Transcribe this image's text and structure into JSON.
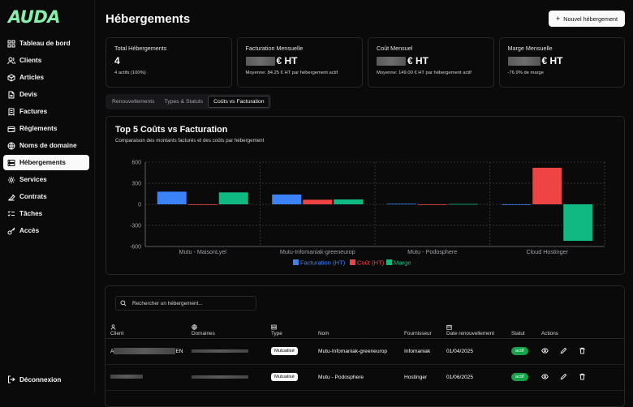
{
  "app": {
    "logo": "AUDA"
  },
  "sidebar": {
    "items": [
      {
        "label": "Tableau de bord",
        "icon": "grid-icon"
      },
      {
        "label": "Clients",
        "icon": "users-icon"
      },
      {
        "label": "Articles",
        "icon": "box-icon"
      },
      {
        "label": "Devis",
        "icon": "file-icon"
      },
      {
        "label": "Factures",
        "icon": "receipt-icon"
      },
      {
        "label": "Règlements",
        "icon": "wallet-icon"
      },
      {
        "label": "Noms de domaine",
        "icon": "globe-icon"
      },
      {
        "label": "Hébergements",
        "icon": "server-icon",
        "active": true
      },
      {
        "label": "Services",
        "icon": "settings-icon"
      },
      {
        "label": "Contrats",
        "icon": "contract-icon"
      },
      {
        "label": "Tâches",
        "icon": "checklist-icon"
      },
      {
        "label": "Accès",
        "icon": "key-icon"
      }
    ],
    "logout": "Déconnexion"
  },
  "header": {
    "title": "Hébergements",
    "new_button": "Nouvel hébergement"
  },
  "cards": [
    {
      "label": "Total Hébergements",
      "value": "4",
      "sub": "4 actifs (100%)"
    },
    {
      "label": "Facturation Mensuelle",
      "value": "€ HT",
      "sub": "Moyenne: 84.25 € HT par hébergement actif"
    },
    {
      "label": "Coût Mensuel",
      "value": "€ HT",
      "sub": "Moyenne: 149.00 € HT par hébergement actif"
    },
    {
      "label": "Marge Mensuelle",
      "value": "€ HT",
      "sub": "-76.9% de marge"
    }
  ],
  "tabs": [
    {
      "label": "Renouvellements"
    },
    {
      "label": "Types & Statuts"
    },
    {
      "label": "Coûts vs Facturation",
      "active": true
    }
  ],
  "chart_data": {
    "type": "bar",
    "title": "Top 5 Coûts vs Facturation",
    "subtitle": "Comparaison des montants facturés et des coûts par hébergement",
    "categories": [
      "Mutu - MaisonLyel",
      "Mutu-Infomaniak-greeneurop",
      "Mutu - Podosphere",
      "Cloud Hostinger"
    ],
    "series": [
      {
        "name": "Facturation (HT)",
        "color": "#3b82f6",
        "values": [
          180,
          140,
          8,
          0
        ]
      },
      {
        "name": "Coût (HT)",
        "color": "#ef4444",
        "values": [
          0,
          65,
          0,
          520
        ]
      },
      {
        "name": "Marge",
        "color": "#10b981",
        "values": [
          170,
          70,
          5,
          -520
        ]
      }
    ],
    "y_ticks": [
      "600",
      "300",
      "0",
      "-300",
      "-600"
    ],
    "ylim": [
      -600,
      600
    ],
    "grid": true,
    "legend": "bottom"
  },
  "search": {
    "placeholder": "Rechercher un hébergement..."
  },
  "table": {
    "columns": [
      "Client",
      "Domaines",
      "Type",
      "Nom",
      "Fournisseur",
      "Date renouvellement",
      "Statut",
      "Actions"
    ],
    "rows": [
      {
        "client_prefix": "A",
        "client_suffix": "EN",
        "type": "Mutualisé",
        "nom": "Mutu-Infomaniak-greeneurop",
        "fournisseur": "Infomaniak",
        "date": "01/04/2025",
        "statut": "actif"
      },
      {
        "client_prefix": "",
        "client_suffix": "",
        "type": "Mutualisé",
        "nom": "Mutu - Podosphere",
        "fournisseur": "Hostinger",
        "date": "01/06/2025",
        "statut": "actif"
      }
    ]
  }
}
